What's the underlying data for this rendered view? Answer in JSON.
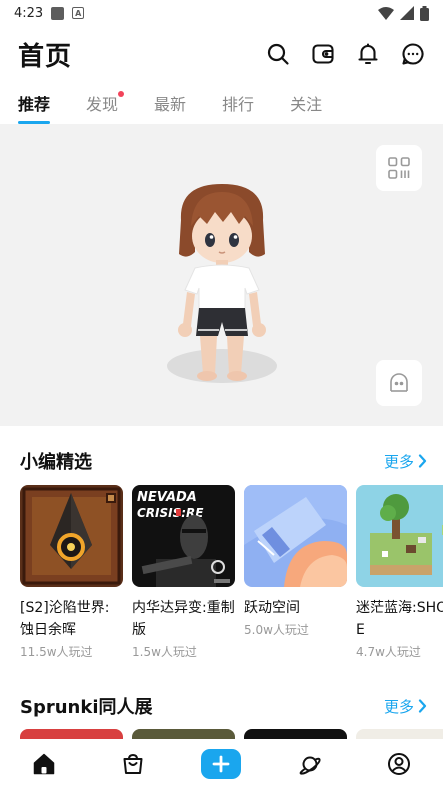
{
  "status_bar": {
    "time": "4:23"
  },
  "header": {
    "title": "首页"
  },
  "tabs": [
    {
      "label": "推荐",
      "active": true
    },
    {
      "label": "发现",
      "active": false,
      "badge": true
    },
    {
      "label": "最新",
      "active": false
    },
    {
      "label": "排行",
      "active": false
    },
    {
      "label": "关注",
      "active": false
    }
  ],
  "featured": {
    "title": "小编精选",
    "more": "更多",
    "items": [
      {
        "name": "[S2]沦陷世界:蚀日余晖",
        "plays": "11.5w人玩过"
      },
      {
        "name": "内华达异变:重制版",
        "plays": "1.5w人玩过",
        "thumb_text": [
          "NEVADA",
          "CRISIS:RE"
        ]
      },
      {
        "name": "跃动空间",
        "plays": "5.0w人玩过"
      },
      {
        "name": "迷茫蓝海:SHORE",
        "plays": "4.7w人玩过"
      }
    ]
  },
  "fan_section": {
    "title": "Sprunki同人展",
    "more": "更多"
  },
  "colors": {
    "accent": "#1aa6ee",
    "badge": "#f2435a"
  },
  "icons": {
    "header": [
      "search-icon",
      "wallet-icon",
      "bell-icon",
      "chat-icon"
    ],
    "banner": [
      "qr-code-icon",
      "avatar-face-icon"
    ],
    "nav": [
      "home-icon",
      "shop-bag-icon",
      "add-icon",
      "planet-icon",
      "profile-icon"
    ]
  }
}
